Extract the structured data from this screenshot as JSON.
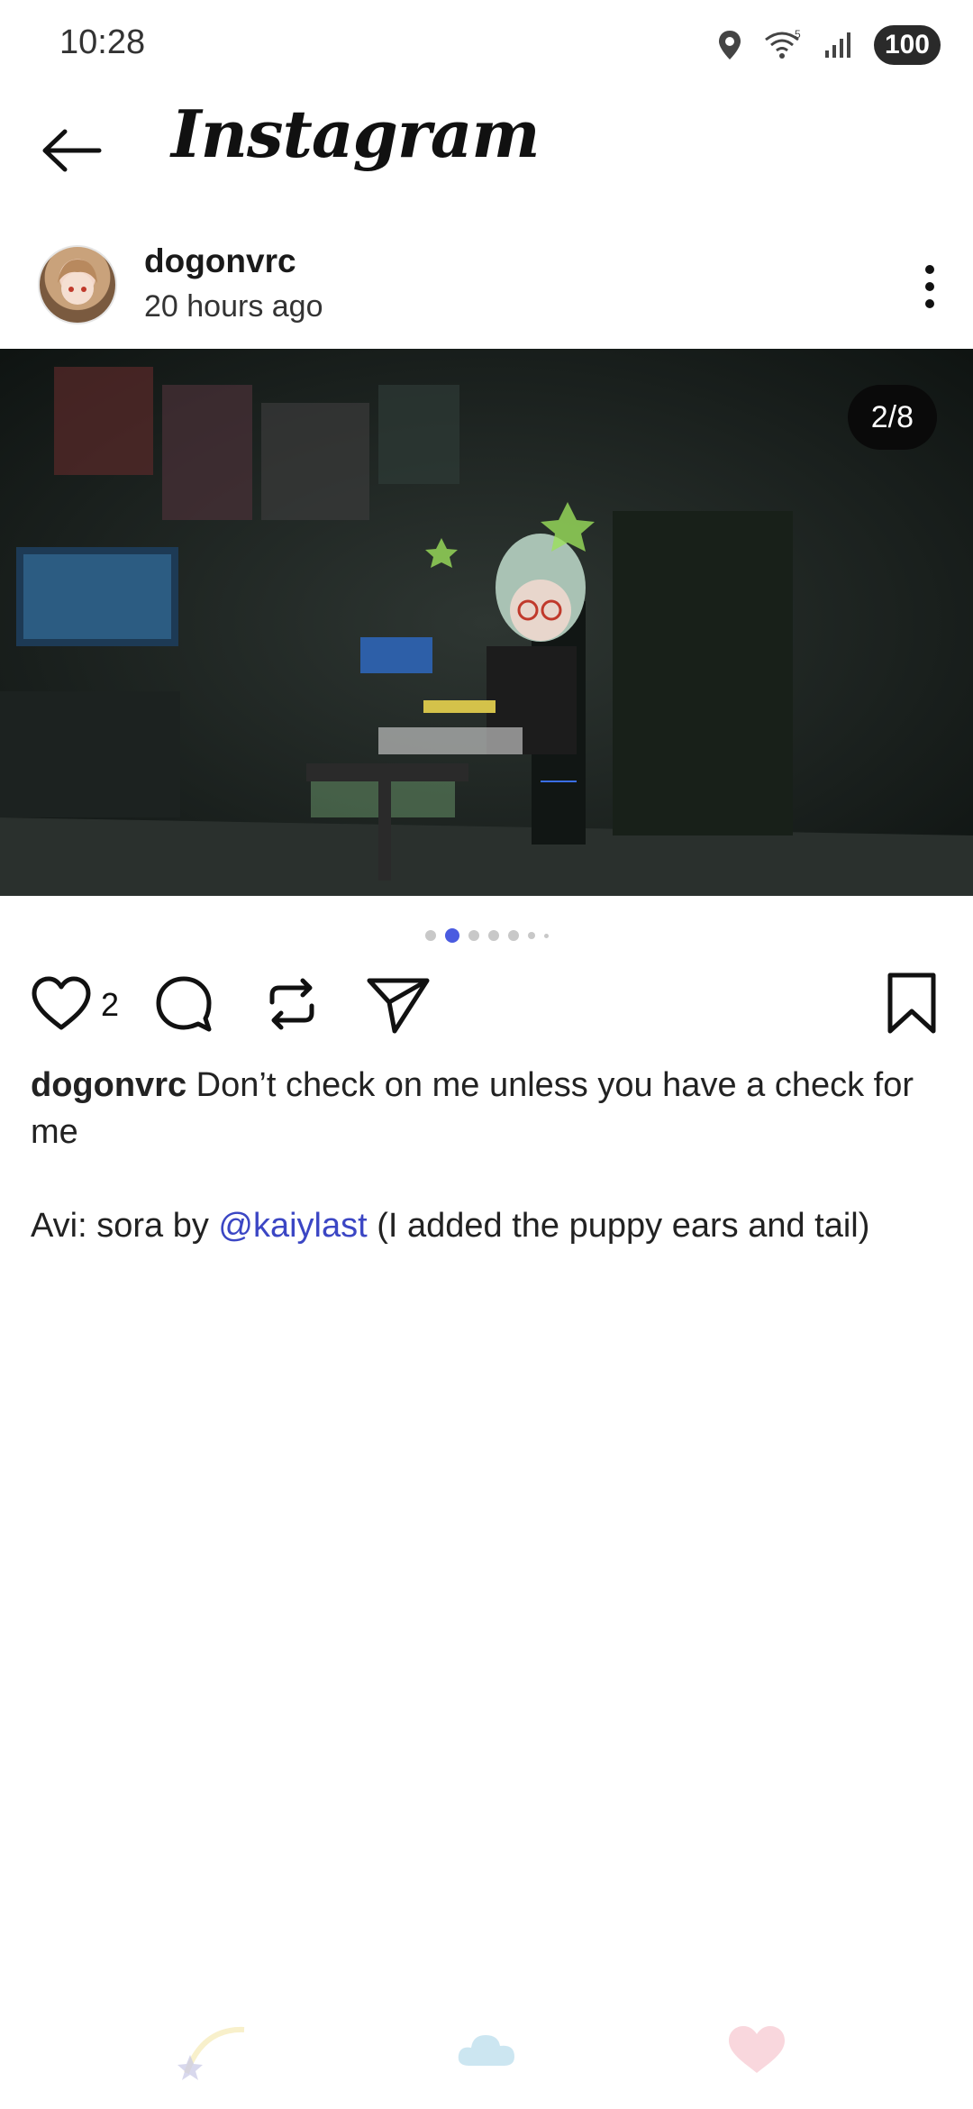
{
  "status_bar": {
    "time": "10:28",
    "battery": "100",
    "icons": [
      "location-icon",
      "wifi-icon",
      "signal-icon",
      "battery-icon"
    ]
  },
  "header": {
    "back_icon": "arrow-left-icon",
    "title": "Instagram"
  },
  "post": {
    "username": "dogonvrc",
    "time_ago": "20 hours ago",
    "media_counter": "2/8",
    "current_slide": 2,
    "total_slides": 8,
    "like_count": "2",
    "caption_user": "dogonvrc",
    "caption_text": " Don’t check on me unless you have a check for me",
    "caption_line2_prefix": "Avi: sora by ",
    "caption_mention": "@kaiylast",
    "caption_line2_suffix": " (I added the puppy ears and tail)"
  },
  "colors": {
    "accent": "#4a5be0",
    "mention": "#3b46c4",
    "text": "#1a1a1a"
  }
}
